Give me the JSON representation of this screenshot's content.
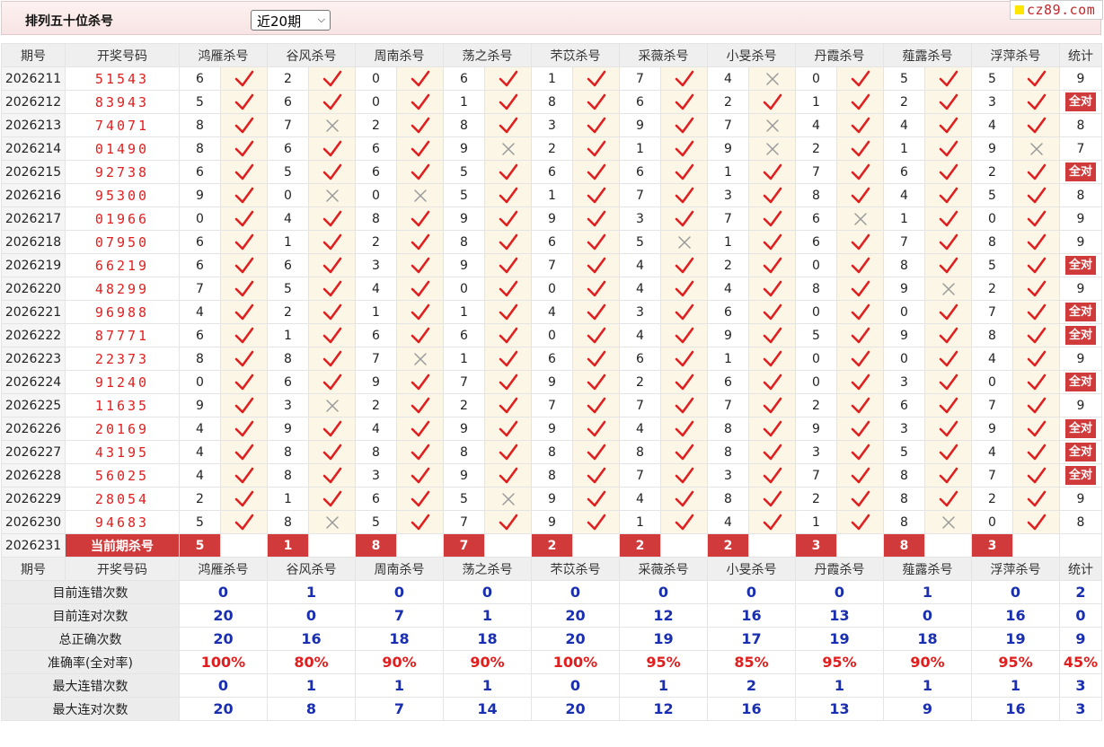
{
  "header": {
    "title": "排列五十位杀号",
    "period_selected": "近20期",
    "logo": "cz89.com"
  },
  "columns": {
    "issue": "期号",
    "draw": "开奖号码",
    "experts": [
      "鸿雁杀号",
      "谷风杀号",
      "周南杀号",
      "荡之杀号",
      "芣苡杀号",
      "采薇杀号",
      "小旻杀号",
      "丹霞杀号",
      "薤露杀号",
      "浮萍杀号"
    ],
    "stat": "统计"
  },
  "full_label": "全对",
  "rows": [
    {
      "issue": "2026211",
      "draw": "51543",
      "kills": [
        6,
        2,
        0,
        6,
        1,
        7,
        4,
        0,
        5,
        5
      ],
      "hits": [
        1,
        1,
        1,
        1,
        1,
        1,
        0,
        1,
        1,
        1
      ],
      "stat": "9"
    },
    {
      "issue": "2026212",
      "draw": "83943",
      "kills": [
        5,
        6,
        0,
        1,
        8,
        6,
        2,
        1,
        2,
        3
      ],
      "hits": [
        1,
        1,
        1,
        1,
        1,
        1,
        1,
        1,
        1,
        1
      ],
      "stat": "全对"
    },
    {
      "issue": "2026213",
      "draw": "74071",
      "kills": [
        8,
        7,
        2,
        8,
        3,
        9,
        7,
        4,
        4,
        4
      ],
      "hits": [
        1,
        0,
        1,
        1,
        1,
        1,
        0,
        1,
        1,
        1
      ],
      "stat": "8"
    },
    {
      "issue": "2026214",
      "draw": "01490",
      "kills": [
        8,
        6,
        6,
        9,
        2,
        1,
        9,
        2,
        1,
        9
      ],
      "hits": [
        1,
        1,
        1,
        0,
        1,
        1,
        0,
        1,
        1,
        0
      ],
      "stat": "7"
    },
    {
      "issue": "2026215",
      "draw": "92738",
      "kills": [
        6,
        5,
        6,
        5,
        6,
        6,
        1,
        7,
        6,
        2
      ],
      "hits": [
        1,
        1,
        1,
        1,
        1,
        1,
        1,
        1,
        1,
        1
      ],
      "stat": "全对"
    },
    {
      "issue": "2026216",
      "draw": "95300",
      "kills": [
        9,
        0,
        0,
        5,
        1,
        7,
        3,
        8,
        4,
        5
      ],
      "hits": [
        1,
        0,
        0,
        1,
        1,
        1,
        1,
        1,
        1,
        1
      ],
      "stat": "8"
    },
    {
      "issue": "2026217",
      "draw": "01966",
      "kills": [
        0,
        4,
        8,
        9,
        9,
        3,
        7,
        6,
        1,
        0
      ],
      "hits": [
        1,
        1,
        1,
        1,
        1,
        1,
        1,
        0,
        1,
        1
      ],
      "stat": "9"
    },
    {
      "issue": "2026218",
      "draw": "07950",
      "kills": [
        6,
        1,
        2,
        8,
        6,
        5,
        1,
        6,
        7,
        8
      ],
      "hits": [
        1,
        1,
        1,
        1,
        1,
        0,
        1,
        1,
        1,
        1
      ],
      "stat": "9"
    },
    {
      "issue": "2026219",
      "draw": "66219",
      "kills": [
        6,
        6,
        3,
        9,
        7,
        4,
        2,
        0,
        8,
        5
      ],
      "hits": [
        1,
        1,
        1,
        1,
        1,
        1,
        1,
        1,
        1,
        1
      ],
      "stat": "全对"
    },
    {
      "issue": "2026220",
      "draw": "48299",
      "kills": [
        7,
        5,
        4,
        0,
        0,
        4,
        4,
        8,
        9,
        2
      ],
      "hits": [
        1,
        1,
        1,
        1,
        1,
        1,
        1,
        1,
        0,
        1
      ],
      "stat": "9"
    },
    {
      "issue": "2026221",
      "draw": "96988",
      "kills": [
        4,
        2,
        1,
        1,
        4,
        3,
        6,
        0,
        0,
        7
      ],
      "hits": [
        1,
        1,
        1,
        1,
        1,
        1,
        1,
        1,
        1,
        1
      ],
      "stat": "全对"
    },
    {
      "issue": "2026222",
      "draw": "87771",
      "kills": [
        6,
        1,
        6,
        6,
        0,
        4,
        9,
        5,
        9,
        8
      ],
      "hits": [
        1,
        1,
        1,
        1,
        1,
        1,
        1,
        1,
        1,
        1
      ],
      "stat": "全对"
    },
    {
      "issue": "2026223",
      "draw": "22373",
      "kills": [
        8,
        8,
        7,
        1,
        6,
        6,
        1,
        0,
        0,
        4
      ],
      "hits": [
        1,
        1,
        0,
        1,
        1,
        1,
        1,
        1,
        1,
        1
      ],
      "stat": "9"
    },
    {
      "issue": "2026224",
      "draw": "91240",
      "kills": [
        0,
        6,
        9,
        7,
        9,
        2,
        6,
        0,
        3,
        0
      ],
      "hits": [
        1,
        1,
        1,
        1,
        1,
        1,
        1,
        1,
        1,
        1
      ],
      "stat": "全对"
    },
    {
      "issue": "2026225",
      "draw": "11635",
      "kills": [
        9,
        3,
        2,
        2,
        7,
        7,
        7,
        2,
        6,
        7
      ],
      "hits": [
        1,
        0,
        1,
        1,
        1,
        1,
        1,
        1,
        1,
        1
      ],
      "stat": "9"
    },
    {
      "issue": "2026226",
      "draw": "20169",
      "kills": [
        4,
        9,
        4,
        9,
        9,
        4,
        8,
        9,
        3,
        9
      ],
      "hits": [
        1,
        1,
        1,
        1,
        1,
        1,
        1,
        1,
        1,
        1
      ],
      "stat": "全对"
    },
    {
      "issue": "2026227",
      "draw": "43195",
      "kills": [
        4,
        8,
        8,
        8,
        8,
        8,
        8,
        3,
        5,
        4
      ],
      "hits": [
        1,
        1,
        1,
        1,
        1,
        1,
        1,
        1,
        1,
        1
      ],
      "stat": "全对"
    },
    {
      "issue": "2026228",
      "draw": "56025",
      "kills": [
        4,
        8,
        3,
        9,
        8,
        7,
        3,
        7,
        8,
        7
      ],
      "hits": [
        1,
        1,
        1,
        1,
        1,
        1,
        1,
        1,
        1,
        1
      ],
      "stat": "全对"
    },
    {
      "issue": "2026229",
      "draw": "28054",
      "kills": [
        2,
        1,
        6,
        5,
        9,
        4,
        8,
        2,
        8,
        2
      ],
      "hits": [
        1,
        1,
        1,
        0,
        1,
        1,
        1,
        1,
        1,
        1
      ],
      "stat": "9"
    },
    {
      "issue": "2026230",
      "draw": "94683",
      "kills": [
        5,
        8,
        5,
        7,
        9,
        1,
        4,
        1,
        8,
        0
      ],
      "hits": [
        1,
        0,
        1,
        1,
        1,
        1,
        1,
        1,
        0,
        1
      ],
      "stat": "8"
    }
  ],
  "current": {
    "issue": "2026231",
    "label": "当前期杀号",
    "kills": [
      "5",
      "1",
      "8",
      "7",
      "2",
      "2",
      "2",
      "3",
      "8",
      "3"
    ]
  },
  "summary": [
    {
      "label": "目前连错次数",
      "values": [
        "0",
        "1",
        "0",
        "0",
        "0",
        "0",
        "0",
        "0",
        "1",
        "0"
      ],
      "stat": "2"
    },
    {
      "label": "目前连对次数",
      "values": [
        "20",
        "0",
        "7",
        "1",
        "20",
        "12",
        "16",
        "13",
        "0",
        "16"
      ],
      "stat": "0"
    },
    {
      "label": "总正确次数",
      "values": [
        "20",
        "16",
        "18",
        "18",
        "20",
        "19",
        "17",
        "19",
        "18",
        "19"
      ],
      "stat": "9"
    },
    {
      "label": "准确率(全对率)",
      "values": [
        "100%",
        "80%",
        "90%",
        "90%",
        "100%",
        "95%",
        "85%",
        "95%",
        "90%",
        "95%"
      ],
      "stat": "45%",
      "pct": true
    },
    {
      "label": "最大连错次数",
      "values": [
        "0",
        "1",
        "1",
        "1",
        "0",
        "1",
        "2",
        "1",
        "1",
        "1"
      ],
      "stat": "3"
    },
    {
      "label": "最大连对次数",
      "values": [
        "20",
        "8",
        "7",
        "14",
        "20",
        "12",
        "16",
        "13",
        "9",
        "16"
      ],
      "stat": "3"
    }
  ],
  "colors": {
    "accent_red": "#d03a3a",
    "check_red": "#e02020",
    "summary_blue": "#1a2fb0",
    "cross_gray": "#9a9a9a"
  },
  "icons": {
    "hit": "check-icon",
    "miss": "cross-icon"
  }
}
